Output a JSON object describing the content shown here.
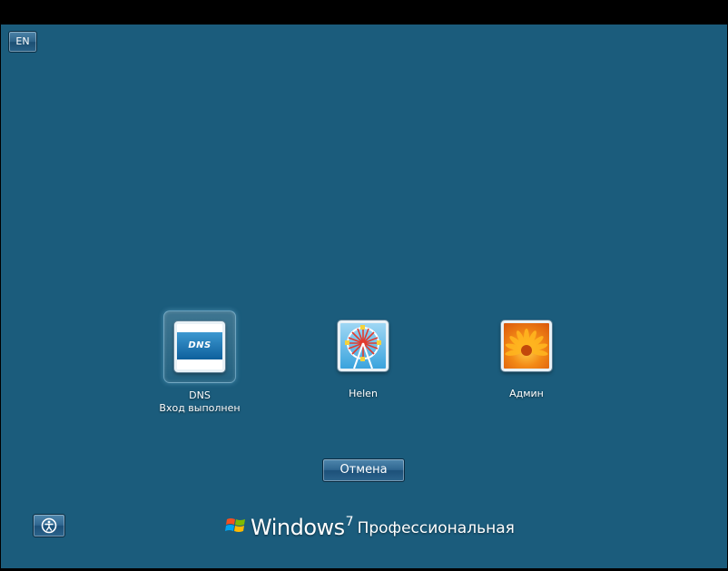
{
  "language": {
    "code": "EN"
  },
  "users": [
    {
      "name": "DNS",
      "status": "Вход выполнен",
      "picture": "dns-logo-picture",
      "picture_text": "DNS",
      "selected": true
    },
    {
      "name": "Helen",
      "status": "",
      "picture": "ferris-wheel-picture",
      "selected": false
    },
    {
      "name": "Админ",
      "status": "",
      "picture": "orange-flower-picture",
      "selected": false
    }
  ],
  "cancel_button": {
    "label": "Отмена"
  },
  "accessibility_button": {
    "icon": "ease-of-access-icon"
  },
  "brand": {
    "logo_icon": "windows-flag-icon",
    "word": "Windows",
    "version": "7",
    "edition": "Профессиональная"
  },
  "colors": {
    "background": "#1b5c7c",
    "button_top": "#4f87ad",
    "button_bottom": "#1c5079"
  }
}
